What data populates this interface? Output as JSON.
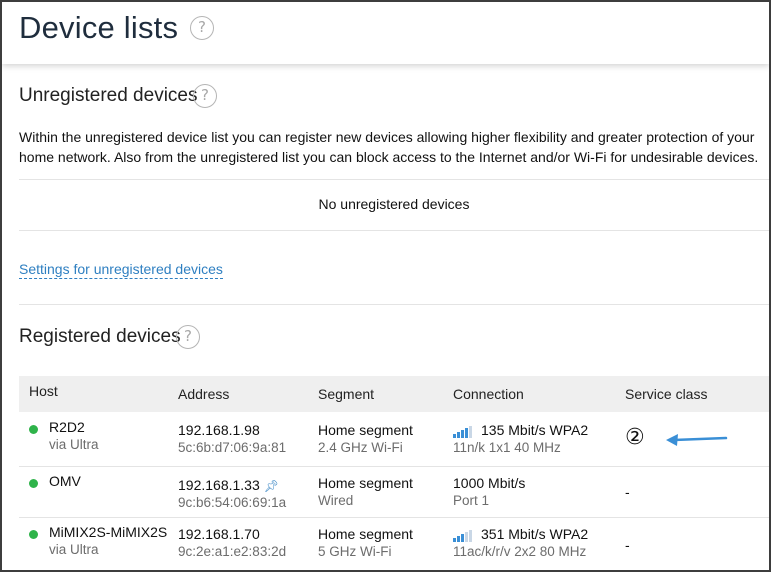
{
  "header": {
    "title": "Device lists",
    "help_glyph": "?"
  },
  "unregistered": {
    "title": "Unregistered devices",
    "description": "Within the unregistered device list you can register new devices allowing higher flexibility and greater protection of your home network. Also from the unregistered list you can block access to the Internet and/or Wi-Fi for undesirable devices.",
    "empty_message": "No unregistered devices",
    "settings_link": "Settings for unregistered devices"
  },
  "registered": {
    "title": "Registered devices",
    "columns": {
      "host": "Host",
      "address": "Address",
      "segment": "Segment",
      "connection": "Connection",
      "service_class": "Service class"
    },
    "rows": [
      {
        "host": "R2D2",
        "host_sub": "via Ultra",
        "ip": "192.168.1.98",
        "mac": "5c:6b:d7:06:9a:81",
        "segment": "Home segment",
        "segment_sub": "2.4 GHz Wi-Fi",
        "connection": "135 Mbit/s WPA2",
        "connection_sub": "11n/k 1x1 40 MHz",
        "signal_level": 4,
        "service_class": "②"
      },
      {
        "host": "OMV",
        "host_sub": "",
        "ip": "192.168.1.33",
        "mac": "9c:b6:54:06:69:1a",
        "segment": "Home segment",
        "segment_sub": "Wired",
        "connection": "1000 Mbit/s",
        "connection_sub": "Port 1",
        "service_class": "-"
      },
      {
        "host": "MiMIX2S-MiMIX2S",
        "host_sub": "via Ultra",
        "ip": "192.168.1.70",
        "mac": "9c:2e:a1:e2:83:2d",
        "segment": "Home segment",
        "segment_sub": "5 GHz Wi-Fi",
        "connection": "351 Mbit/s WPA2",
        "connection_sub": "11ac/k/r/v 2x2 80 MHz",
        "signal_level": 3,
        "service_class": "-"
      }
    ]
  },
  "colors": {
    "accent": "#2e7fc1",
    "online": "#2fb34a",
    "annotation_arrow": "#3a8fd6"
  }
}
